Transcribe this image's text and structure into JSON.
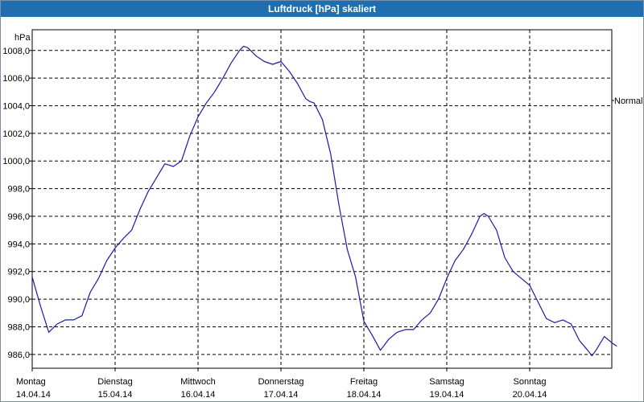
{
  "window": {
    "title": "Luftdruck [hPa] skaliert"
  },
  "chart_data": {
    "type": "line",
    "title": "Luftdruck [hPa] skaliert",
    "ylabel": "hPa",
    "right_label": "Normal",
    "ylim": [
      985.0,
      1009.5
    ],
    "xlim": [
      0,
      7
    ],
    "grid": true,
    "y_ticks": [
      "1008,0",
      "1006,0",
      "1004,0",
      "1002,0",
      "1000,0",
      "998,0",
      "996,0",
      "994,0",
      "992,0",
      "990,0",
      "988,0",
      "986,0"
    ],
    "x_ticks": [
      {
        "day": "Montag",
        "date": "14.04.14"
      },
      {
        "day": "Dienstag",
        "date": "15.04.14"
      },
      {
        "day": "Mittwoch",
        "date": "16.04.14"
      },
      {
        "day": "Donnerstag",
        "date": "17.04.14"
      },
      {
        "day": "Freitag",
        "date": "18.04.14"
      },
      {
        "day": "Samstag",
        "date": "19.04.14"
      },
      {
        "day": "Sonntag",
        "date": "20.04.14"
      }
    ],
    "series": [
      {
        "color": "#1a1aaa",
        "points": [
          [
            0.0,
            991.6
          ],
          [
            0.1,
            989.5
          ],
          [
            0.2,
            987.6
          ],
          [
            0.3,
            988.2
          ],
          [
            0.4,
            988.5
          ],
          [
            0.5,
            988.5
          ],
          [
            0.6,
            988.8
          ],
          [
            0.7,
            990.5
          ],
          [
            0.8,
            991.5
          ],
          [
            0.9,
            992.8
          ],
          [
            1.0,
            993.7
          ],
          [
            1.1,
            994.4
          ],
          [
            1.2,
            995.0
          ],
          [
            1.3,
            996.5
          ],
          [
            1.4,
            997.8
          ],
          [
            1.5,
            998.8
          ],
          [
            1.6,
            999.8
          ],
          [
            1.7,
            999.6
          ],
          [
            1.8,
            1000.0
          ],
          [
            1.9,
            1001.8
          ],
          [
            2.0,
            1003.2
          ],
          [
            2.1,
            1004.2
          ],
          [
            2.2,
            1005.0
          ],
          [
            2.3,
            1006.0
          ],
          [
            2.4,
            1007.1
          ],
          [
            2.5,
            1008.0
          ],
          [
            2.55,
            1008.3
          ],
          [
            2.6,
            1008.2
          ],
          [
            2.7,
            1007.6
          ],
          [
            2.8,
            1007.2
          ],
          [
            2.9,
            1007.0
          ],
          [
            3.0,
            1007.2
          ],
          [
            3.1,
            1006.5
          ],
          [
            3.2,
            1005.6
          ],
          [
            3.3,
            1004.5
          ],
          [
            3.35,
            1004.3
          ],
          [
            3.4,
            1004.2
          ],
          [
            3.5,
            1003.0
          ],
          [
            3.6,
            1000.5
          ],
          [
            3.7,
            996.8
          ],
          [
            3.8,
            993.6
          ],
          [
            3.9,
            991.6
          ],
          [
            4.0,
            988.4
          ],
          [
            4.05,
            987.9
          ],
          [
            4.1,
            987.4
          ],
          [
            4.2,
            986.3
          ],
          [
            4.3,
            987.1
          ],
          [
            4.4,
            987.6
          ],
          [
            4.5,
            987.8
          ],
          [
            4.6,
            987.8
          ],
          [
            4.7,
            988.5
          ],
          [
            4.8,
            989.0
          ],
          [
            4.9,
            990.0
          ],
          [
            5.0,
            991.5
          ],
          [
            5.1,
            992.8
          ],
          [
            5.2,
            993.6
          ],
          [
            5.3,
            994.7
          ],
          [
            5.4,
            996.0
          ],
          [
            5.45,
            996.2
          ],
          [
            5.5,
            996.0
          ],
          [
            5.6,
            995.0
          ],
          [
            5.7,
            993.0
          ],
          [
            5.8,
            992.0
          ],
          [
            5.9,
            991.5
          ],
          [
            6.0,
            991.0
          ],
          [
            6.1,
            989.8
          ],
          [
            6.2,
            988.6
          ],
          [
            6.3,
            988.3
          ],
          [
            6.4,
            988.5
          ],
          [
            6.5,
            988.2
          ],
          [
            6.6,
            987.0
          ],
          [
            6.7,
            986.3
          ],
          [
            6.75,
            985.9
          ],
          [
            6.8,
            986.3
          ],
          [
            6.9,
            987.3
          ],
          [
            7.0,
            986.8
          ],
          [
            7.05,
            986.6
          ]
        ]
      }
    ]
  }
}
